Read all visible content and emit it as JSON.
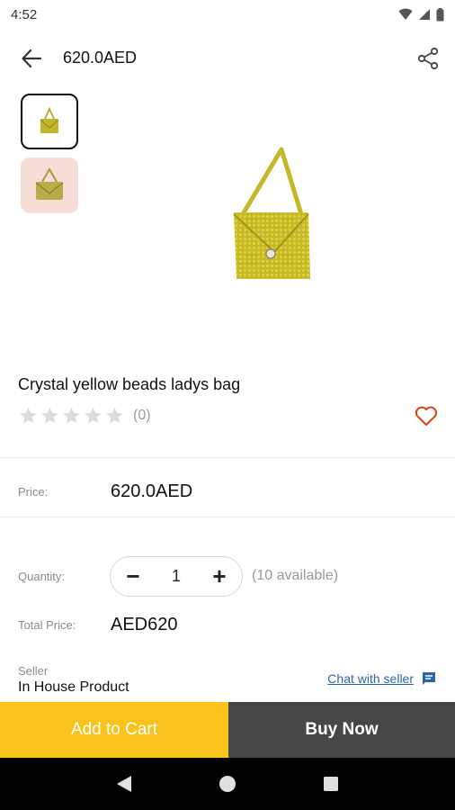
{
  "status_bar": {
    "time": "4:52"
  },
  "app_bar": {
    "title": "620.0AED"
  },
  "product": {
    "title": "Crystal yellow beads ladys bag",
    "rating": 0,
    "rating_max": 5,
    "review_count": "(0)"
  },
  "price": {
    "label": "Price:",
    "value": "620.0AED"
  },
  "quantity": {
    "label": "Quantity:",
    "value": "1",
    "minus": "−",
    "plus": "+",
    "available": "(10 available)"
  },
  "total": {
    "label": "Total Price:",
    "value": "AED620"
  },
  "seller": {
    "label": "Seller",
    "name": "In House Product",
    "chat": "Chat with seller"
  },
  "actions": {
    "add_to_cart": "Add to Cart",
    "buy_now": "Buy Now"
  },
  "colors": {
    "accent": "#f9c31b",
    "buy": "#474747",
    "wishlist": "#d84315",
    "link": "#2b66a7",
    "bag": "#c2b52a"
  },
  "icons": [
    "back-arrow-icon",
    "share-icon",
    "star-icon",
    "heart-icon",
    "chat-icon",
    "nav-back-icon",
    "nav-home-icon",
    "nav-recents-icon"
  ]
}
